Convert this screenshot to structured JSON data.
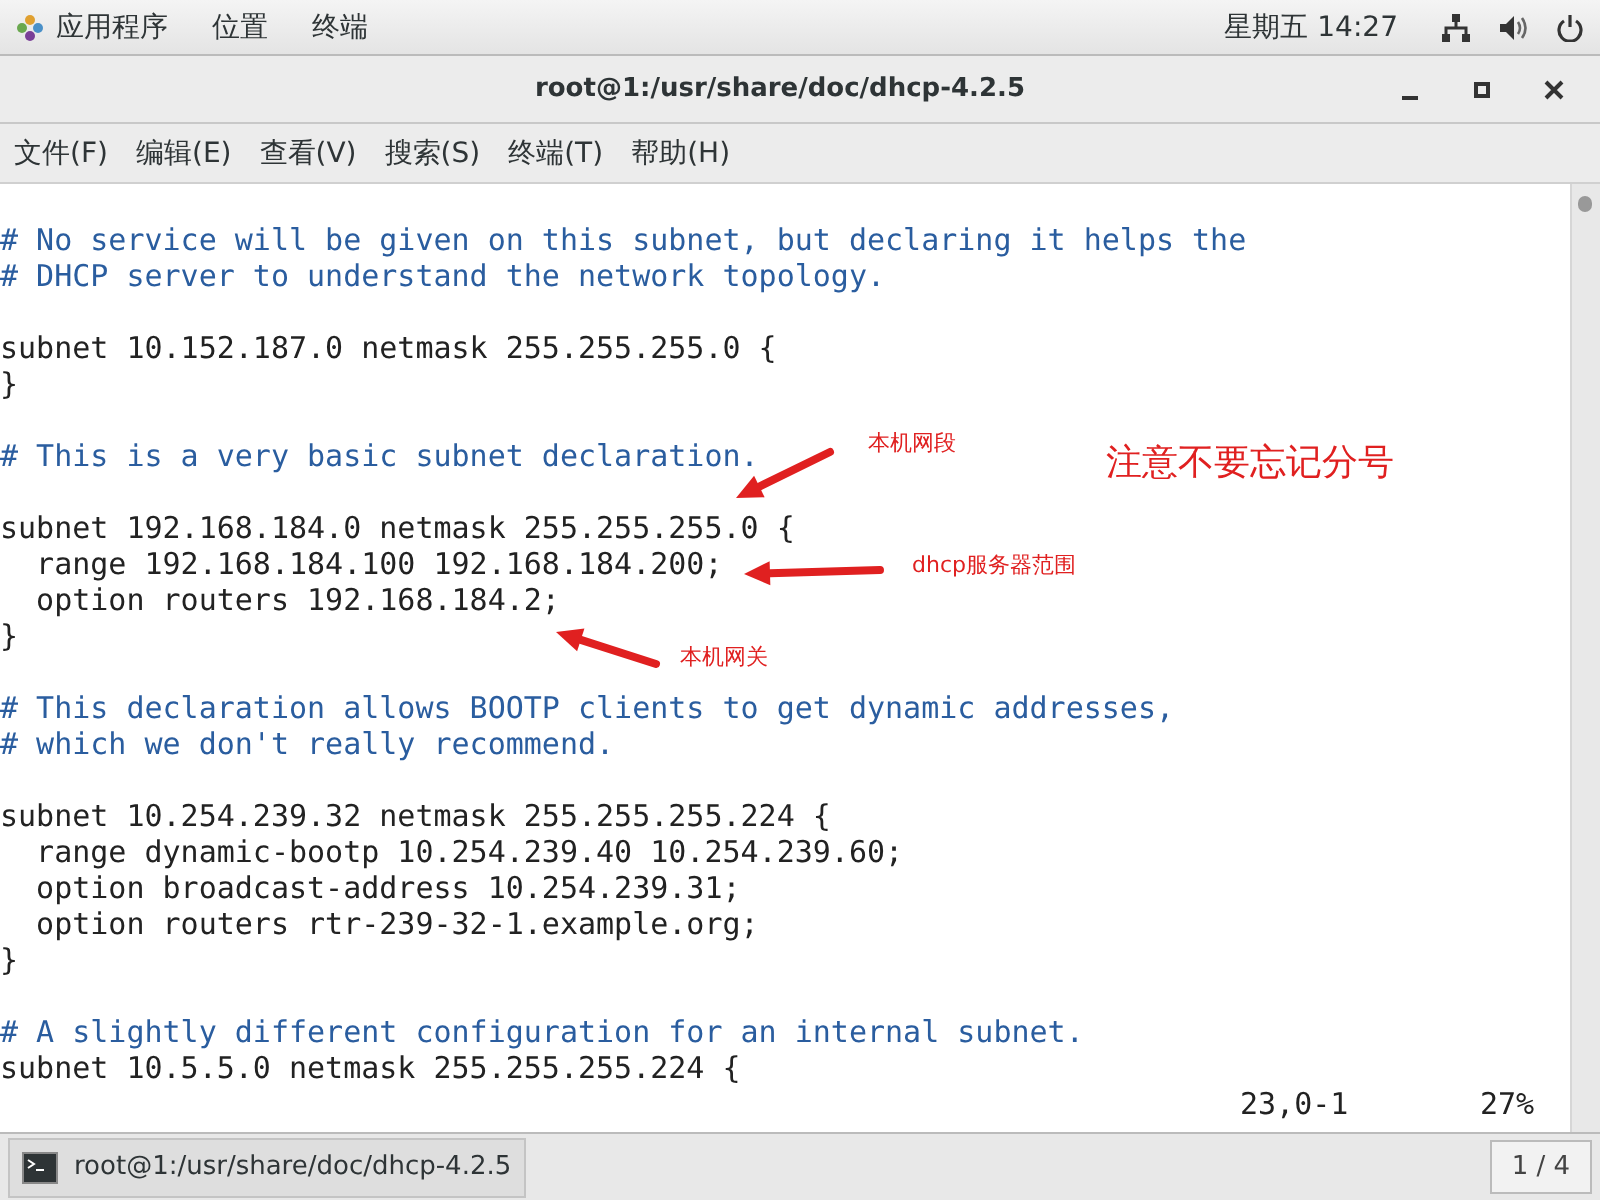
{
  "top_bar": {
    "menus": [
      "应用程序",
      "位置",
      "终端"
    ],
    "clock": "星期五 14:27"
  },
  "window": {
    "title": "root@1:/usr/share/doc/dhcp-4.2.5"
  },
  "menu_bar": [
    "文件(F)",
    "编辑(E)",
    "查看(V)",
    "搜索(S)",
    "终端(T)",
    "帮助(H)"
  ],
  "terminal": {
    "lines": [
      {
        "kind": "blank"
      },
      {
        "kind": "comment",
        "text": "# No service will be given on this subnet, but declaring it helps the"
      },
      {
        "kind": "comment",
        "text": "# DHCP server to understand the network topology."
      },
      {
        "kind": "blank"
      },
      {
        "kind": "code",
        "text": "subnet 10.152.187.0 netmask 255.255.255.0 {"
      },
      {
        "kind": "code",
        "text": "}"
      },
      {
        "kind": "blank"
      },
      {
        "kind": "comment",
        "text": "# This is a very basic subnet declaration."
      },
      {
        "kind": "blank"
      },
      {
        "kind": "code",
        "text": "subnet 192.168.184.0 netmask 255.255.255.0 {"
      },
      {
        "kind": "code",
        "text": "  range 192.168.184.100 192.168.184.200;"
      },
      {
        "kind": "code",
        "text": "  option routers 192.168.184.2;"
      },
      {
        "kind": "code",
        "text": "}"
      },
      {
        "kind": "blank"
      },
      {
        "kind": "comment",
        "text": "# This declaration allows BOOTP clients to get dynamic addresses,"
      },
      {
        "kind": "comment",
        "text": "# which we don't really recommend."
      },
      {
        "kind": "blank"
      },
      {
        "kind": "code",
        "text": "subnet 10.254.239.32 netmask 255.255.255.224 {"
      },
      {
        "kind": "code",
        "text": "  range dynamic-bootp 10.254.239.40 10.254.239.60;"
      },
      {
        "kind": "code",
        "text": "  option broadcast-address 10.254.239.31;"
      },
      {
        "kind": "code",
        "text": "  option routers rtr-239-32-1.example.org;"
      },
      {
        "kind": "code",
        "text": "}"
      },
      {
        "kind": "blank"
      },
      {
        "kind": "comment",
        "text": "# A slightly different configuration for an internal subnet."
      },
      {
        "kind": "code",
        "text": "subnet 10.5.5.0 netmask 255.255.255.224 {"
      }
    ],
    "position": "23,0-1",
    "percent": "27%"
  },
  "annotations": [
    {
      "kind": "arrow-note",
      "text": "本机网段"
    },
    {
      "kind": "heading",
      "text": "注意不要忘记分号"
    },
    {
      "kind": "arrow-note",
      "text": "dhcp服务器范围"
    },
    {
      "kind": "arrow-note",
      "text": "本机网关"
    }
  ],
  "taskbar": {
    "task": "root@1:/usr/share/doc/dhcp-4.2.5",
    "workspace": "1 / 4"
  }
}
